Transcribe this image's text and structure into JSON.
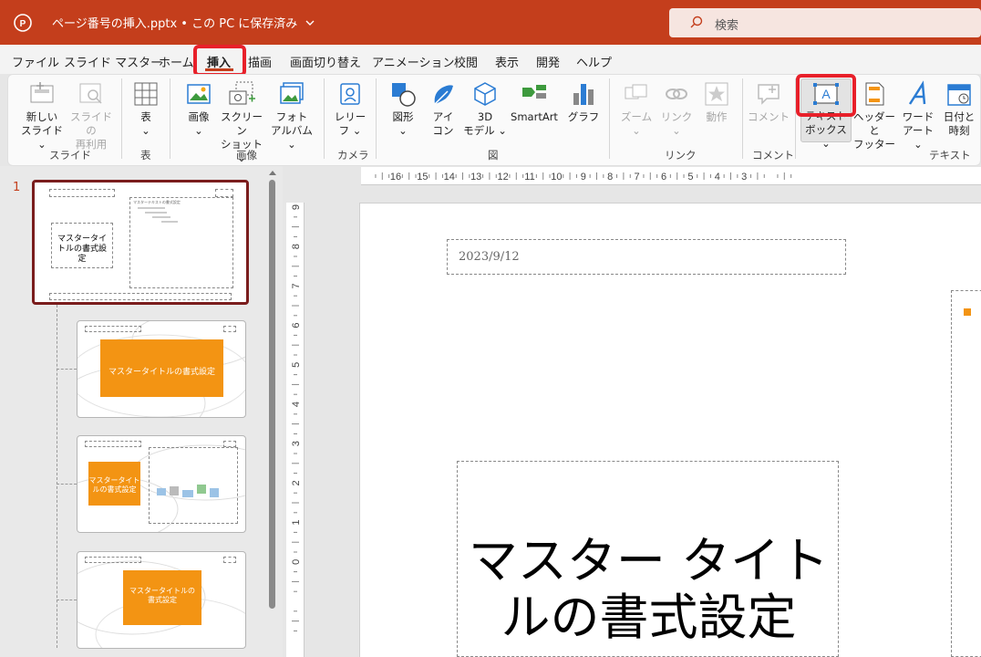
{
  "titlebar": {
    "doc_title": "ページ番号の挿入.pptx • この PC に保存済み",
    "search_placeholder": "検索",
    "accent": "#c43e1c"
  },
  "menu": {
    "tabs": [
      "ファイル",
      "スライド マスター",
      "ホーム",
      "挿入",
      "描画",
      "画面切り替え",
      "アニメーション",
      "校閲",
      "表示",
      "開発",
      "ヘルプ"
    ],
    "active": "挿入"
  },
  "ribbon": {
    "groups": {
      "slide": "スライド",
      "table": "表",
      "image": "画像",
      "camera": "カメラ",
      "figure": "図",
      "link": "リンク",
      "comment": "コメント",
      "text": "テキスト"
    },
    "buttons": {
      "new_slide_1": "新しい",
      "new_slide_2": "スライド",
      "reuse_1": "スライドの",
      "reuse_2": "再利用",
      "table": "表",
      "pictures": "画像",
      "screenshot_1": "スクリーン",
      "screenshot_2": "ショット",
      "photo_album_1": "フォト",
      "photo_album_2": "アルバム",
      "cameo_1": "レリー",
      "cameo_2": "フ",
      "shapes": "図形",
      "icons_1": "アイ",
      "icons_2": "コン",
      "model3d_1": "3D",
      "model3d_2": "モデル",
      "smartart": "SmartArt",
      "chart": "グラフ",
      "zoom": "ズーム",
      "link": "リンク",
      "action": "動作",
      "comment": "コメント",
      "textbox_1": "テキスト",
      "textbox_2": "ボックス",
      "header_footer_1": "ヘッダーと",
      "header_footer_2": "フッター",
      "wordart_1": "ワード",
      "wordart_2": "アート",
      "datetime_1": "日付と",
      "datetime_2": "時刻"
    }
  },
  "thumbnails": {
    "slide_number": "1",
    "master_title_small": "マスタータイトルの書式設定",
    "layout1_title": "マスタータイトルの書式設定",
    "layout2_title": "マスタータイトルの書式設定",
    "layout3_title": "マスタータイトルの書式設定",
    "master_text_small": "マスターテキストの書式設定"
  },
  "rulers": {
    "horizontal": [
      "16",
      "15",
      "14",
      "13",
      "12",
      "11",
      "10",
      "9",
      "8",
      "7",
      "6",
      "5",
      "4",
      "3"
    ],
    "vertical": [
      "9",
      "8",
      "7",
      "6",
      "5",
      "4",
      "3",
      "2",
      "1",
      "0"
    ]
  },
  "slide": {
    "date": "2023/9/12",
    "title": "マスター タイトルの書式設定"
  }
}
